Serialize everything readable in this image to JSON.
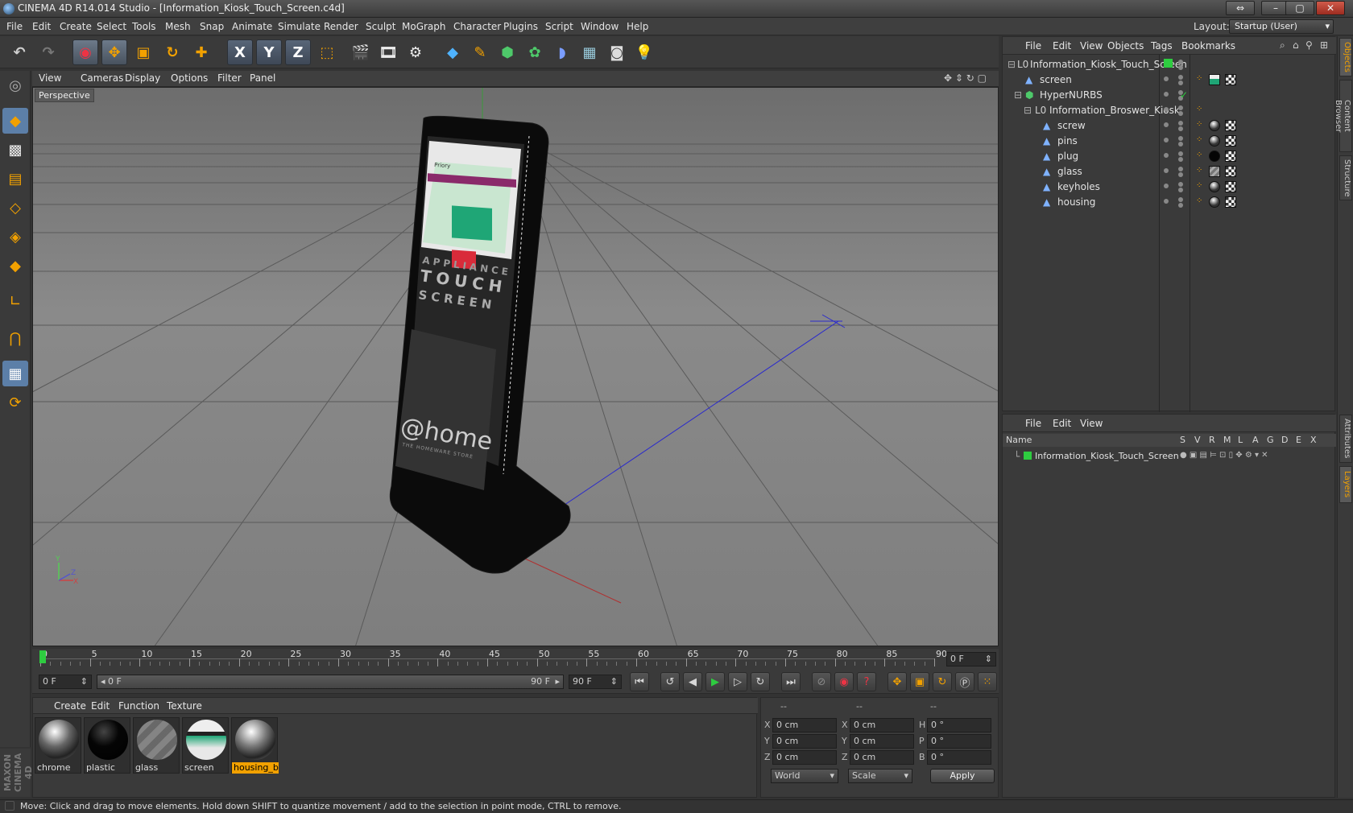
{
  "window": {
    "title": "CINEMA 4D R14.014 Studio - [Information_Kiosk_Touch_Screen.c4d]",
    "controls": [
      "⇔",
      "–",
      "▢",
      "✕"
    ]
  },
  "menu": {
    "items": [
      "File",
      "Edit",
      "Create",
      "Select",
      "Tools",
      "Mesh",
      "Snap",
      "Animate",
      "Simulate",
      "Render",
      "Sculpt",
      "MoGraph",
      "Character",
      "Plugins",
      "Script",
      "Window",
      "Help"
    ],
    "layout_label": "Layout:",
    "layout_value": "Startup (User)"
  },
  "toolbar": {
    "icons": [
      "undo-icon",
      "redo-icon",
      "live-select-icon",
      "move-icon",
      "scale-icon",
      "rotate-icon",
      "create-object-icon",
      "x-axis-icon",
      "y-axis-icon",
      "z-axis-icon",
      "coordinate-system-icon",
      "render-view-icon",
      "render-picture-viewer-icon",
      "edit-render-settings-icon",
      "cube-icon",
      "spline-pen-icon",
      "subdivision-icon",
      "cloner-icon",
      "deformer-icon",
      "floor-icon",
      "camera-icon",
      "light-icon"
    ],
    "axis_labels": [
      "X",
      "Y",
      "Z"
    ]
  },
  "left_tools": [
    "make-editable-icon",
    "model-mode-icon",
    "texture-mode-icon",
    "workplane-icon",
    "point-mode-icon",
    "edge-mode-icon",
    "polygon-mode-icon",
    "axis-mode-icon",
    "magnet-icon",
    "snap-grid-icon",
    "tweak-mode-icon"
  ],
  "viewport": {
    "menu": [
      "View",
      "Cameras",
      "Display",
      "Options",
      "Filter",
      "Panel"
    ],
    "label": "Perspective",
    "kiosk": {
      "screen_header": "Priory",
      "screen_text": [
        "APPLIANCE",
        "TOUCH",
        "SCREEN"
      ],
      "logo": "@home",
      "logo_sub": "THE HOMEWARE STORE"
    },
    "axis_gizmo": [
      "Y",
      "X",
      "Z"
    ]
  },
  "timeline": {
    "ticks": [
      "0",
      "5",
      "10",
      "15",
      "20",
      "25",
      "30",
      "35",
      "40",
      "45",
      "50",
      "55",
      "60",
      "65",
      "70",
      "75",
      "80",
      "85",
      "90"
    ],
    "current_frame": "0 F",
    "start_field": "0 F",
    "range_start": "0 F",
    "range_end": "90 F",
    "end_field": "90 F"
  },
  "material_manager": {
    "menu": [
      "Create",
      "Edit",
      "Function",
      "Texture"
    ],
    "materials": [
      {
        "name": "chrome",
        "selected": false
      },
      {
        "name": "plastic",
        "selected": false
      },
      {
        "name": "glass",
        "selected": false
      },
      {
        "name": "screen",
        "selected": false
      },
      {
        "name": "housing_b",
        "selected": true
      }
    ],
    "branding": "MAXON CINEMA 4D"
  },
  "coordinates": {
    "headers": [
      "--",
      "--",
      "--"
    ],
    "rows": [
      {
        "axis": "X",
        "pos": "0 cm",
        "axis2": "X",
        "size": "0 cm",
        "rot_label": "H",
        "rot": "0 °"
      },
      {
        "axis": "Y",
        "pos": "0 cm",
        "axis2": "Y",
        "size": "0 cm",
        "rot_label": "P",
        "rot": "0 °"
      },
      {
        "axis": "Z",
        "pos": "0 cm",
        "axis2": "Z",
        "size": "0 cm",
        "rot_label": "B",
        "rot": "0 °"
      }
    ],
    "space": "World",
    "mode": "Scale",
    "apply": "Apply"
  },
  "object_manager": {
    "menu": [
      "File",
      "Edit",
      "View",
      "Objects",
      "Tags",
      "Bookmarks"
    ],
    "objects": [
      {
        "name": "Information_Kiosk_Touch_Screen",
        "icon": "null-object-icon",
        "depth": 0
      },
      {
        "name": "screen",
        "icon": "polygon-object-icon",
        "depth": 1
      },
      {
        "name": "HyperNURBS",
        "icon": "hypernurbs-icon",
        "depth": 1
      },
      {
        "name": "Information_Broswer_Kiosk",
        "icon": "null-object-icon",
        "depth": 2
      },
      {
        "name": "screw",
        "icon": "polygon-object-icon",
        "depth": 3
      },
      {
        "name": "pins",
        "icon": "polygon-object-icon",
        "depth": 3
      },
      {
        "name": "plug",
        "icon": "polygon-object-icon",
        "depth": 3
      },
      {
        "name": "glass",
        "icon": "polygon-object-icon",
        "depth": 3
      },
      {
        "name": "keyholes",
        "icon": "polygon-object-icon",
        "depth": 3
      },
      {
        "name": "housing",
        "icon": "polygon-object-icon",
        "depth": 3
      }
    ]
  },
  "layer_manager": {
    "menu": [
      "File",
      "Edit",
      "View"
    ],
    "columns": [
      "Name",
      "S",
      "V",
      "R",
      "M",
      "L",
      "A",
      "G",
      "D",
      "E",
      "X"
    ],
    "layers": [
      {
        "name": "Information_Kiosk_Touch_Screen",
        "color": "#2ecc40"
      }
    ]
  },
  "side_tabs": [
    "Objects",
    "Content Browser",
    "Structure",
    "Attributes",
    "Layers"
  ],
  "status": "Move: Click and drag to move elements. Hold down SHIFT to quantize movement / add to the selection in point mode, CTRL to remove.",
  "colors": {
    "accent": "#f2a100",
    "layer_green": "#2ecc40",
    "selection_blue": "#5c7fa8"
  }
}
